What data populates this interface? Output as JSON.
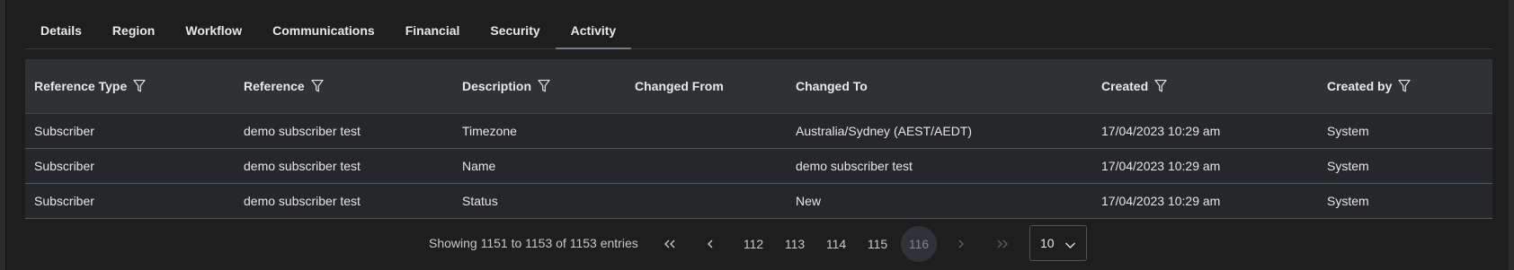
{
  "tabs": [
    {
      "label": "Details"
    },
    {
      "label": "Region"
    },
    {
      "label": "Workflow"
    },
    {
      "label": "Communications"
    },
    {
      "label": "Financial"
    },
    {
      "label": "Security"
    },
    {
      "label": "Activity",
      "active": true
    }
  ],
  "table": {
    "columns": [
      {
        "label": "Reference Type",
        "filter": true
      },
      {
        "label": "Reference",
        "filter": true
      },
      {
        "label": "Description",
        "filter": true
      },
      {
        "label": "Changed From",
        "filter": false
      },
      {
        "label": "Changed To",
        "filter": false
      },
      {
        "label": "Created",
        "filter": true
      },
      {
        "label": "Created by",
        "filter": true
      }
    ],
    "rows": [
      [
        "Subscriber",
        "demo subscriber test",
        "Timezone",
        "",
        "Australia/Sydney (AEST/AEDT)",
        "17/04/2023 10:29 am",
        "System"
      ],
      [
        "Subscriber",
        "demo subscriber test",
        "Name",
        "",
        "demo subscriber test",
        "17/04/2023 10:29 am",
        "System"
      ],
      [
        "Subscriber",
        "demo subscriber test",
        "Status",
        "",
        "New",
        "17/04/2023 10:29 am",
        "System"
      ]
    ]
  },
  "pagination": {
    "info": "Showing 1151 to 1153 of 1153 entries",
    "first": "«",
    "prev": "‹",
    "pages": [
      "112",
      "113",
      "114",
      "115",
      "116"
    ],
    "current_page": "116",
    "next": "›",
    "last": "»",
    "page_size": "10"
  },
  "colors": {
    "background": "#1e1e1e",
    "header_bg": "#2e3235",
    "row_bg": "#25272a",
    "active_tab_underline": "#6f7b86"
  },
  "icons": {
    "filter": "filter-icon",
    "page_size_dropdown": "chevron-down-icon"
  }
}
